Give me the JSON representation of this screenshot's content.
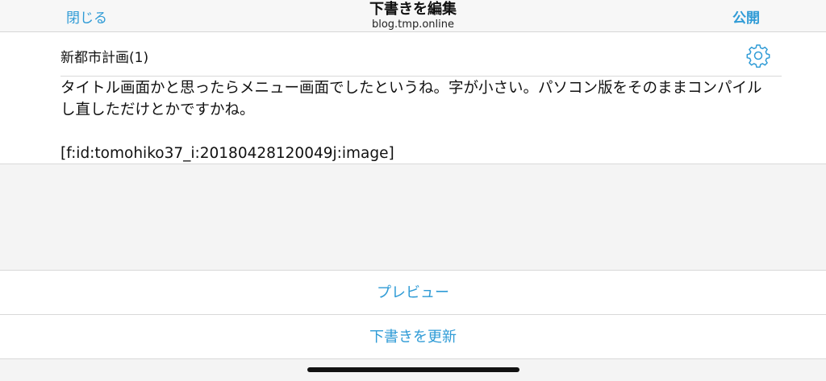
{
  "navbar": {
    "close_label": "閉じる",
    "title": "下書きを編集",
    "subtitle": "blog.tmp.online",
    "publish_label": "公開"
  },
  "editor": {
    "title": "新都市計画(1)",
    "settings_icon": "gear-icon",
    "body": "タイトル画面かと思ったらメニュー画面でしたというね。字が小さい。パソコン版をそのままコンパイルし直しただけとかですかね。\n\n[f:id:tomohiko37_i:20180428120049j:image]"
  },
  "actions": {
    "preview_label": "プレビュー",
    "update_draft_label": "下書きを更新"
  },
  "colors": {
    "accent": "#2f9bd6",
    "background": "#f4f4f4"
  }
}
